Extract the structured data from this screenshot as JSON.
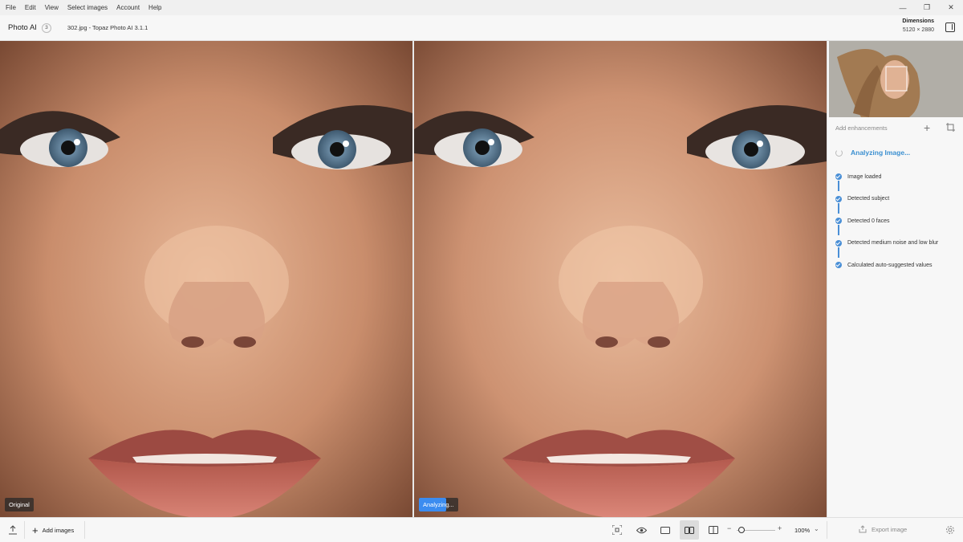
{
  "menu": [
    "File",
    "Edit",
    "View",
    "Select images",
    "Account",
    "Help"
  ],
  "window_controls": {
    "minimize": "—",
    "restore": "❐",
    "close": "✕"
  },
  "header": {
    "app_name": "Photo AI",
    "app_badge": "3",
    "file_title": "302.jpg - Topaz Photo AI 3.1.1",
    "dimensions_label": "Dimensions",
    "dimensions_value": "5120 × 2880"
  },
  "viewer": {
    "left_tag": "Original",
    "right_tag": "Analyzing...",
    "analyzing_progress": 0.7
  },
  "sidebar": {
    "add_enhancements": "Add enhancements",
    "status_title": "Analyzing Image...",
    "steps": [
      "Image loaded",
      "Detected subject",
      "Detected 0 faces",
      "Detected medium noise and low blur",
      "Calculated auto-suggested values"
    ]
  },
  "bottombar": {
    "add_images": "Add images",
    "zoom": "100%",
    "export": "Export image"
  },
  "colors": {
    "accent": "#3a8fd0",
    "progress": "#3b8cf0"
  }
}
